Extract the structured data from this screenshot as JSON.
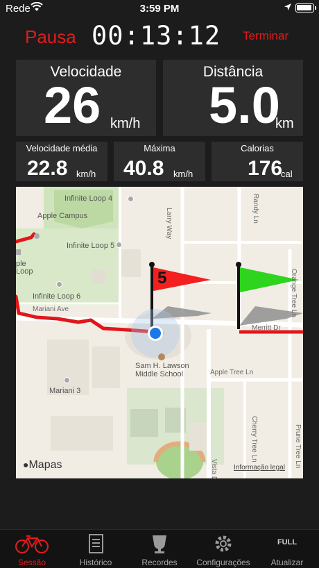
{
  "status": {
    "carrier": "Rede",
    "time": "3:59 PM"
  },
  "controls": {
    "pause_label": "Pausa",
    "timer": "00:13:12",
    "finish_label": "Terminar"
  },
  "stats": {
    "speed": {
      "label": "Velocidade",
      "value": "26",
      "unit": "km/h"
    },
    "distance": {
      "label": "Distância",
      "value": "5.0",
      "unit": "km"
    },
    "avg_speed": {
      "label": "Velocidade média",
      "value": "22.8",
      "unit": "km/h"
    },
    "max_speed": {
      "label": "Máxima",
      "value": "40.8",
      "unit": "km/h"
    },
    "calories": {
      "label": "Calorias",
      "value": "176",
      "unit": "cal"
    }
  },
  "map": {
    "flag_number": "5",
    "places": [
      "Infinite Loop 4",
      "Apple Campus",
      "Infinite Loop 5",
      "Infinite Loop 6",
      "Mariani 3",
      "Sam H. Lawson",
      "Middle School"
    ],
    "partial_place_1": "ple",
    "partial_place_2": "Loop",
    "streets": [
      "Mariani Ave",
      "Merritt Dr",
      "Apple Tree Ln",
      "Larry Way",
      "Randy Ln",
      "Orange Tree Ln",
      "Cherry Tree Ln",
      "Prune Tree Ln",
      "Vista Dr"
    ],
    "logo_text": "Mapas",
    "legal_text": "Informação legal"
  },
  "tabs": [
    {
      "label": "Sessão",
      "icon": "bicycle-icon",
      "active": true
    },
    {
      "label": "Histórico",
      "icon": "notebook-icon",
      "active": false
    },
    {
      "label": "Recordes",
      "icon": "trophy-icon",
      "active": false
    },
    {
      "label": "Configurações",
      "icon": "gear-icon",
      "active": false
    },
    {
      "label": "Atualizar",
      "icon": "full-text-icon",
      "badge_text": "FULL",
      "active": false
    }
  ],
  "colors": {
    "accent": "#e31b1b",
    "tile_bg": "#2d2d2d",
    "route": "#e0161b",
    "current_location": "#1a78e8"
  }
}
